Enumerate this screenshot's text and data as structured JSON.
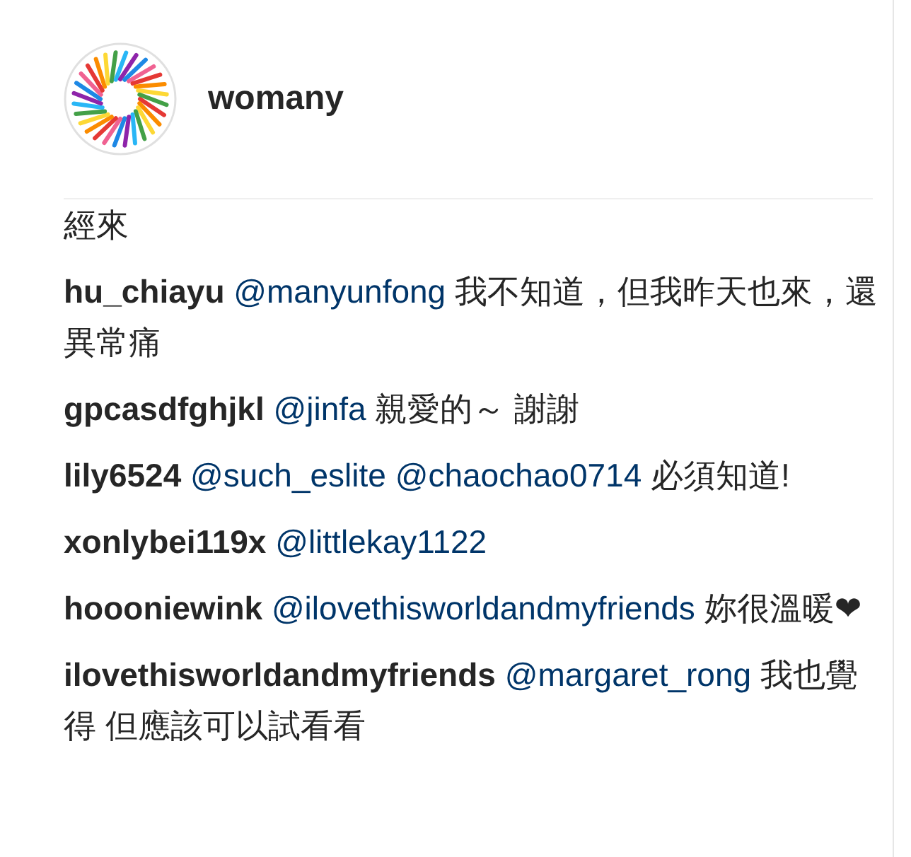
{
  "account": {
    "name": "womany"
  },
  "comments": [
    {
      "parts": [
        {
          "kind": "text",
          "text": "經來"
        }
      ]
    },
    {
      "user": "hu_chiayu",
      "parts": [
        {
          "kind": "mention",
          "text": "@manyunfong"
        },
        {
          "kind": "text",
          "text": "我不知道，但我昨天也來，還異常痛"
        }
      ]
    },
    {
      "user": "gpcasdfghjkl",
      "parts": [
        {
          "kind": "mention",
          "text": "@jinfa"
        },
        {
          "kind": "text",
          "text": "親愛的～ 謝謝"
        }
      ]
    },
    {
      "user": "lily6524",
      "parts": [
        {
          "kind": "mention",
          "text": "@such_eslite"
        },
        {
          "kind": "mention",
          "text": "@chaochao0714"
        },
        {
          "kind": "text",
          "text": "必須知道!"
        }
      ]
    },
    {
      "user": "xonlybei119x",
      "parts": [
        {
          "kind": "mention",
          "text": "@littlekay1122"
        }
      ]
    },
    {
      "user": "hoooniewink",
      "parts": [
        {
          "kind": "mention",
          "text": "@ilovethisworldandmyfriends"
        },
        {
          "kind": "text",
          "text": "妳很溫暖❤"
        }
      ]
    },
    {
      "user": "ilovethisworldandmyfriends",
      "parts": [
        {
          "kind": "mention",
          "text": "@margaret_rong"
        },
        {
          "kind": "text",
          "text": "我也覺得 但應該可以試看看"
        }
      ]
    }
  ]
}
